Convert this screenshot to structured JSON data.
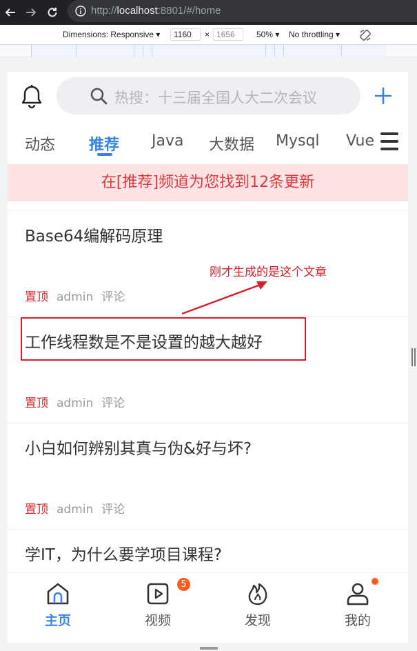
{
  "browser": {
    "url_prefix": "http://",
    "url_host": "localhost",
    "url_rest": ":8801/#/home"
  },
  "devtools": {
    "dimensions_label": "Dimensions: Responsive ▾",
    "width_value": "1160",
    "times": "×",
    "height_value": "1656",
    "zoom_label": "50% ▾",
    "throttling_label": "No throttling ▾"
  },
  "header": {
    "search_placeholder": "热搜：十三届全国人大二次会议"
  },
  "tabs": [
    {
      "label": "动态"
    },
    {
      "label": "推荐"
    },
    {
      "label": "Java"
    },
    {
      "label": "大数据"
    },
    {
      "label": "Mysql"
    },
    {
      "label": "Vue"
    }
  ],
  "notice": "在[推荐]频道为您找到12条更新",
  "articles": [
    {
      "title": "Base64编解码原理",
      "top": "置顶",
      "author": "admin",
      "comment": "评论"
    },
    {
      "title": "工作线程数是不是设置的越大越好",
      "top": "置顶",
      "author": "admin",
      "comment": "评论"
    },
    {
      "title": "小白如何辨别其真与伪&好与坏?",
      "top": "置顶",
      "author": "admin",
      "comment": "评论"
    },
    {
      "title": "学IT，为什么要学项目课程?",
      "top": "",
      "author": "",
      "comment": ""
    }
  ],
  "annotation": "刚才生成的是这个文章",
  "tabbar": {
    "items": [
      {
        "label": "主页",
        "icon": "home-icon"
      },
      {
        "label": "视频",
        "icon": "video-icon"
      },
      {
        "label": "发现",
        "icon": "fire-icon"
      },
      {
        "label": "我的",
        "icon": "user-icon"
      }
    ],
    "video_badge": "5"
  },
  "colors": {
    "accent": "#3a83e2",
    "notice_bg": "#fde3e4",
    "notice_text": "#e1383e",
    "top_tag": "#d42b2b",
    "badge": "#ff5a1f",
    "annotation": "#d61f2a"
  }
}
